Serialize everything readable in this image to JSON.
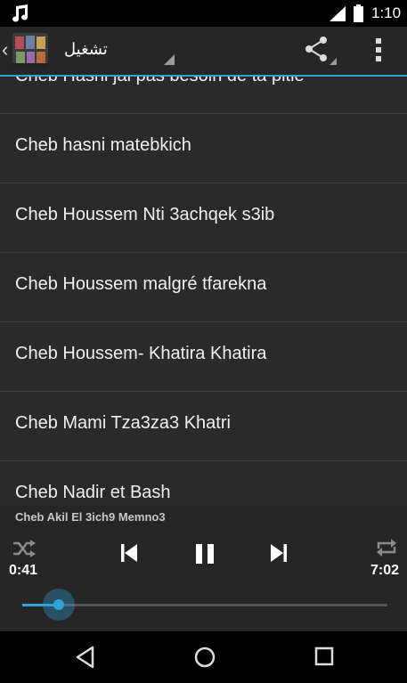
{
  "status_bar": {
    "time": "1:10",
    "icons": [
      "music-note-icon",
      "signal-icon",
      "battery-icon"
    ]
  },
  "action_bar": {
    "title": "تشغيل",
    "icons": [
      "back-chevron-icon",
      "app-icon",
      "share-icon",
      "overflow-menu-icon"
    ]
  },
  "songs": [
    "Cheb Hasni jai pas besoin de ta pitié",
    "Cheb hasni matebkich",
    "Cheb Houssem Nti 3achqek s3ib",
    "Cheb Houssem malgré tfarekna",
    "Cheb Houssem- Khatira Khatira",
    "Cheb Mami Tza3za3 Khatri",
    "Cheb Nadir et Bash"
  ],
  "player": {
    "now_playing": "Cheb Akil El 3ich9 Memno3",
    "elapsed": "0:41",
    "total": "7:02",
    "progress": 0.1,
    "icons": [
      "shuffle-icon",
      "previous-icon",
      "pause-icon",
      "next-icon",
      "repeat-icon"
    ]
  },
  "nav_bar": {
    "icons": [
      "back-icon",
      "home-icon",
      "recents-icon"
    ]
  },
  "colors": {
    "accent": "#2fa3d6",
    "background": "#2a2a2a",
    "bar": "#262626",
    "divider": "#3d3d3d"
  }
}
